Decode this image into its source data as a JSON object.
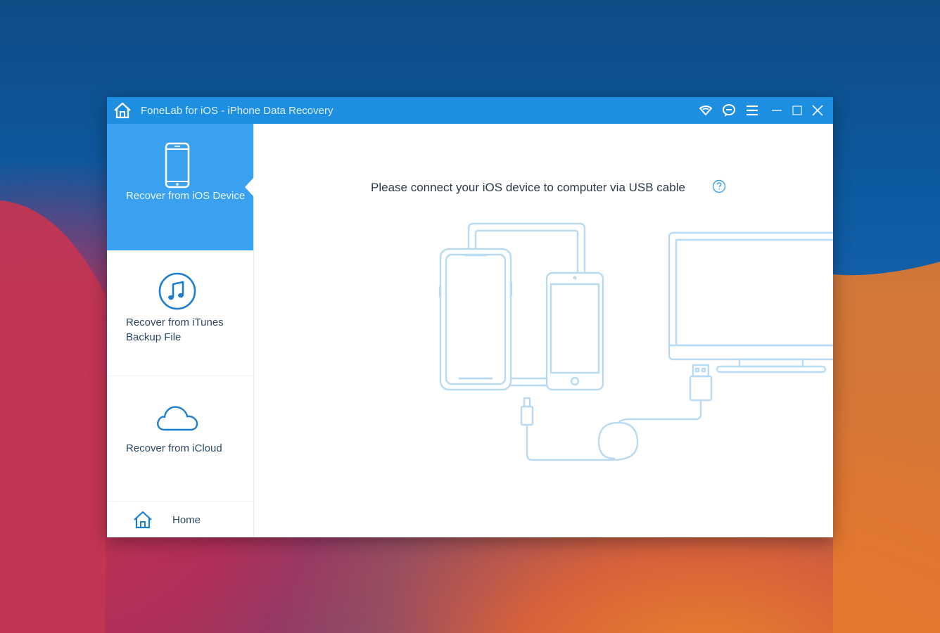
{
  "window": {
    "title": "FoneLab for iOS - iPhone Data Recovery"
  },
  "titlebar_icons": [
    "home-icon",
    "wifi-icon",
    "chat-icon",
    "menu-icon",
    "minimize-icon",
    "maximize-icon",
    "close-icon"
  ],
  "sidebar": {
    "items": [
      {
        "label": "Recover from iOS Device",
        "icon": "iphone-icon",
        "active": true
      },
      {
        "label": "Recover from iTunes Backup File",
        "icon": "music-note-icon",
        "active": false
      },
      {
        "label": "Recover from iCloud",
        "icon": "cloud-icon",
        "active": false
      }
    ],
    "home_label": "Home"
  },
  "main": {
    "instruction": "Please connect your iOS device to computer via USB cable",
    "help_icon": "question-icon"
  },
  "colors": {
    "accent": "#1e8ee0",
    "active_item": "#3aa0f0",
    "illustration_line": "#b9daf3"
  }
}
